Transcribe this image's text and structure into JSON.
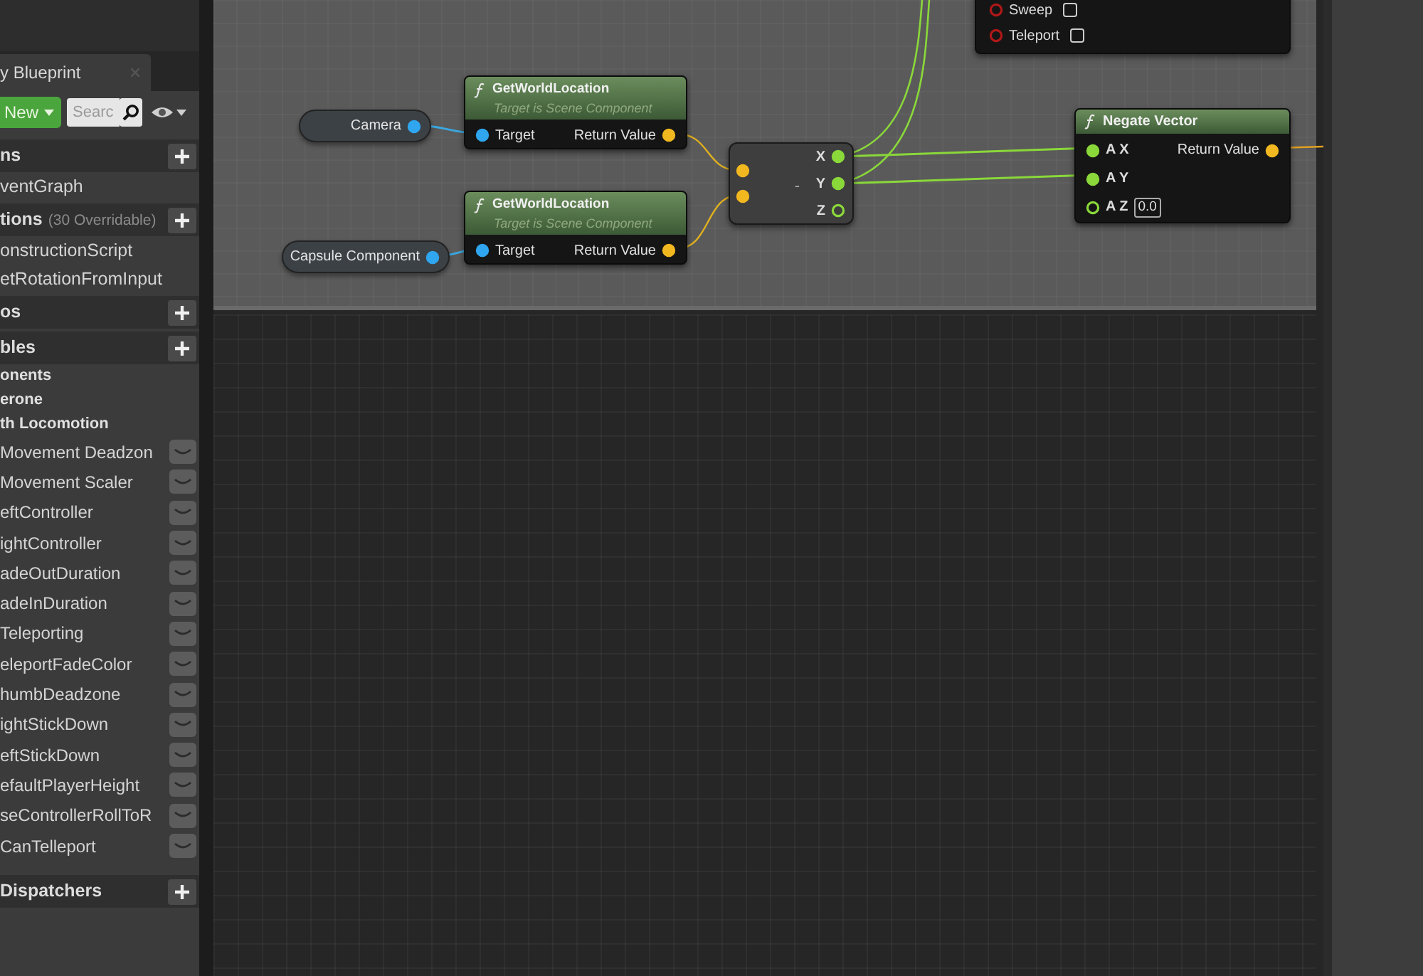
{
  "tab": {
    "title": "y Blueprint"
  },
  "toolbar": {
    "new_button": "New",
    "search_placeholder": "Searc"
  },
  "sections": [
    {
      "title": "ns",
      "items": [
        {
          "kind": "graph",
          "label": "ventGraph"
        }
      ]
    },
    {
      "title": "tions",
      "note": "(30 Overridable)",
      "items": [
        {
          "kind": "function",
          "label": "onstructionScript"
        },
        {
          "kind": "function",
          "label": "etRotationFromInput"
        }
      ]
    },
    {
      "title": "os"
    },
    {
      "title": "bles",
      "items": [
        {
          "kind": "category",
          "label": "onents"
        },
        {
          "kind": "category",
          "label": "erone"
        },
        {
          "kind": "category",
          "label": "th Locomotion"
        },
        {
          "kind": "variable",
          "label": "Movement Deadzon"
        },
        {
          "kind": "variable",
          "label": "Movement Scaler"
        },
        {
          "kind": "variable",
          "label": "eftController"
        },
        {
          "kind": "variable",
          "label": "ightController"
        },
        {
          "kind": "variable",
          "label": "adeOutDuration"
        },
        {
          "kind": "variable",
          "label": "adeInDuration"
        },
        {
          "kind": "variable",
          "label": "Teleporting"
        },
        {
          "kind": "variable",
          "label": "eleportFadeColor"
        },
        {
          "kind": "variable",
          "label": "humbDeadzone"
        },
        {
          "kind": "variable",
          "label": "ightStickDown"
        },
        {
          "kind": "variable",
          "label": "eftStickDown"
        },
        {
          "kind": "variable",
          "label": "efaultPlayerHeight"
        },
        {
          "kind": "variable",
          "label": "seControllerRollToR"
        },
        {
          "kind": "variable",
          "label": "CanTelleport"
        }
      ]
    },
    {
      "title": "Dispatchers"
    }
  ],
  "graph": {
    "variables": [
      {
        "label": "Camera"
      },
      {
        "label": "Capsule Component"
      }
    ],
    "functions": [
      {
        "title": "GetWorldLocation",
        "subtitle": "Target is Scene Component",
        "input": "Target",
        "output": "Return Value"
      },
      {
        "title": "GetWorldLocation",
        "subtitle": "Target is Scene Component",
        "input": "Target",
        "output": "Return Value"
      }
    ],
    "break_node": {
      "symbol": "-",
      "pins": [
        {
          "label": "X",
          "connected": true
        },
        {
          "label": "Y",
          "connected": true
        },
        {
          "label": "Z",
          "connected": false
        }
      ]
    },
    "negate_node": {
      "title": "Negate Vector",
      "inputs": [
        {
          "label": "A X",
          "connected": true
        },
        {
          "label": "A Y",
          "connected": true
        },
        {
          "label": "A Z",
          "connected": false,
          "value": "0.0"
        }
      ],
      "output": "Return Value"
    },
    "partial_node": {
      "options": [
        {
          "label": "Sweep",
          "checked": false
        },
        {
          "label": "Teleport",
          "checked": false
        }
      ]
    }
  }
}
